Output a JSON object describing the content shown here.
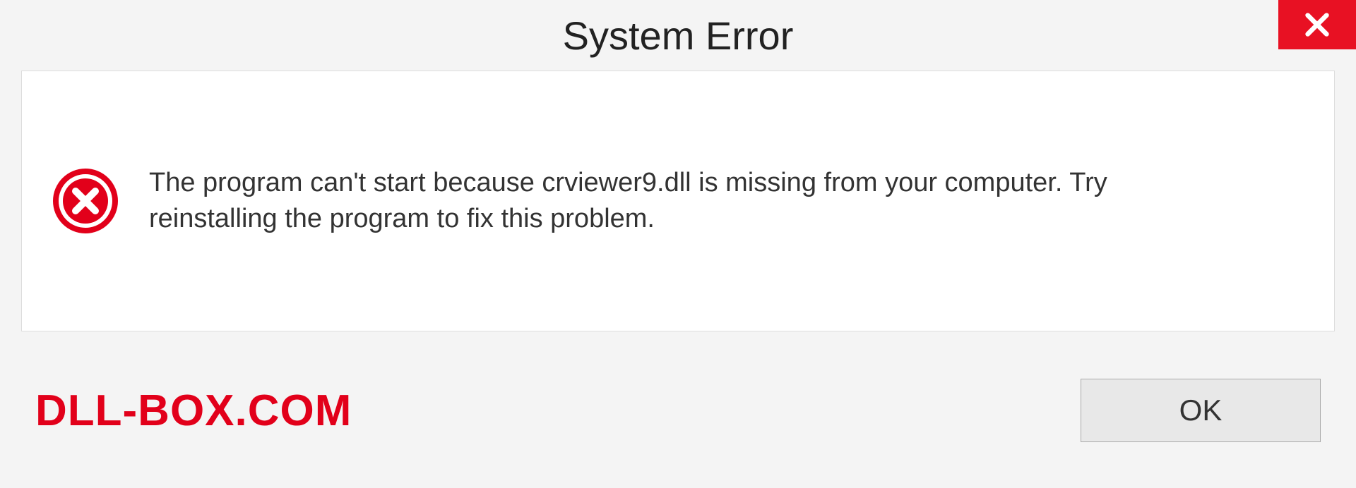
{
  "dialog": {
    "title": "System Error",
    "message": "The program can't start because crviewer9.dll is missing from your computer. Try reinstalling the program to fix this problem.",
    "ok_label": "OK"
  },
  "watermark": "DLL-BOX.COM"
}
